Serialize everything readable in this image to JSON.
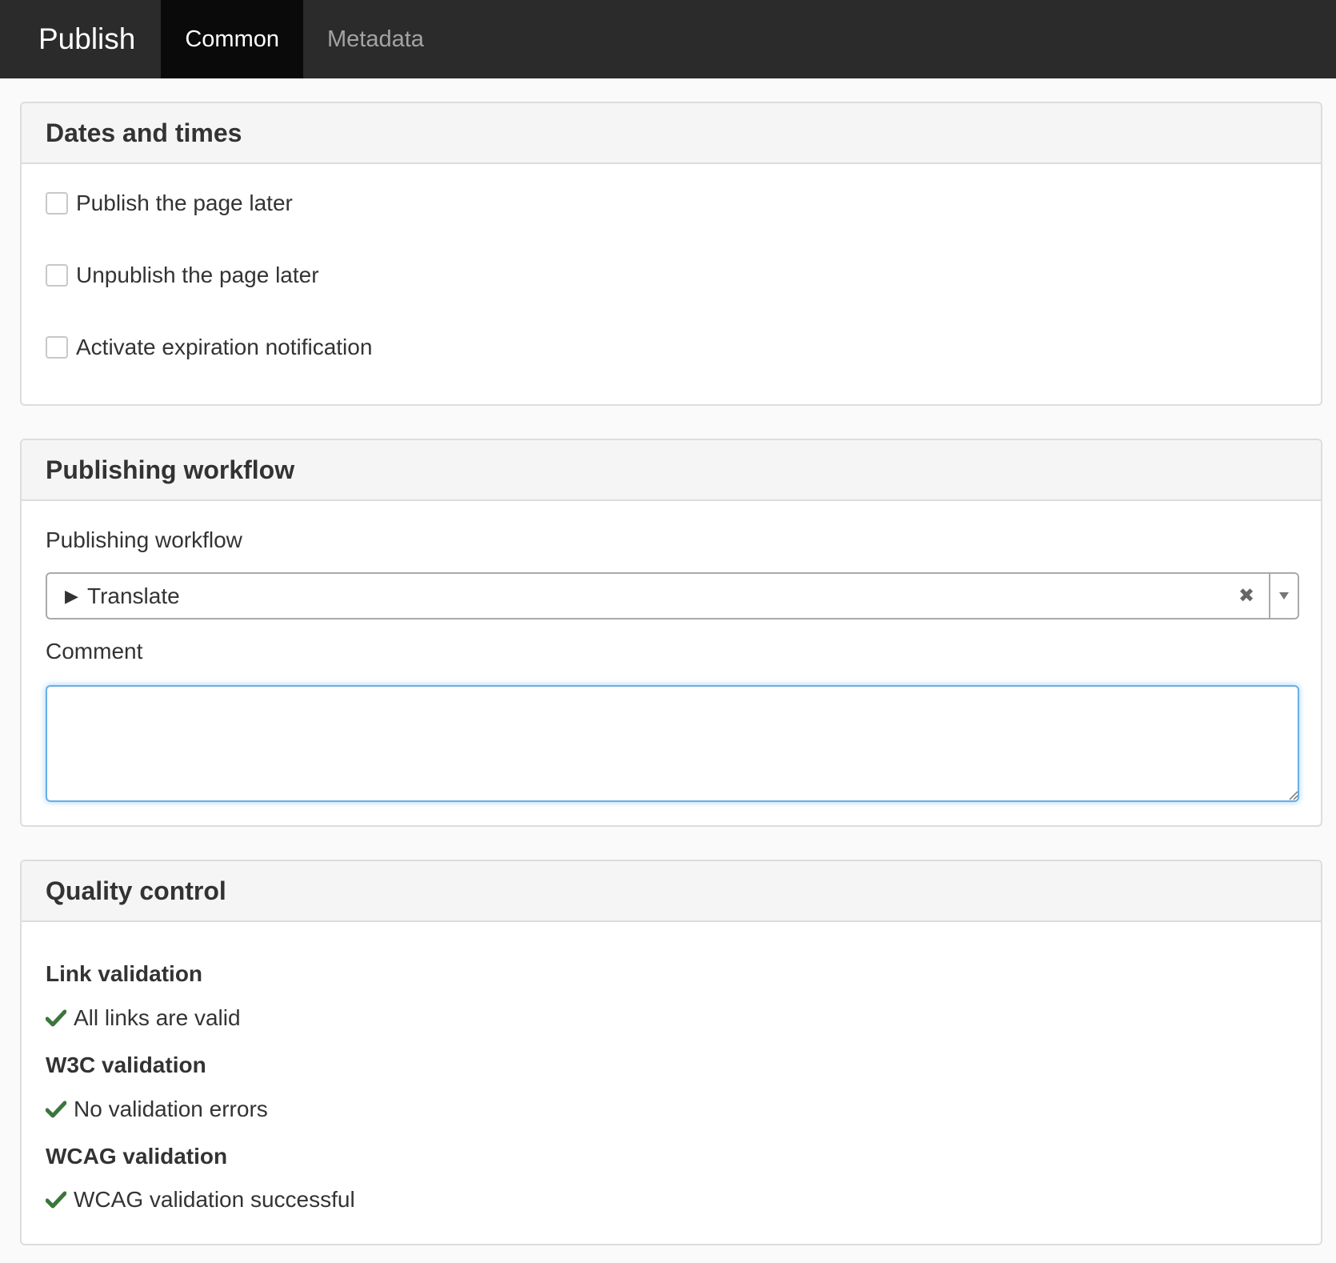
{
  "topbar": {
    "title": "Publish",
    "tabs": [
      {
        "label": "Common",
        "active": true
      },
      {
        "label": "Metadata",
        "active": false
      }
    ]
  },
  "dates_panel": {
    "heading": "Dates and times",
    "options": [
      {
        "label": "Publish the page later",
        "checked": false
      },
      {
        "label": "Unpublish the page later",
        "checked": false
      },
      {
        "label": "Activate expiration notification",
        "checked": false
      }
    ]
  },
  "workflow_panel": {
    "heading": "Publishing workflow",
    "workflow_label": "Publishing workflow",
    "workflow_selected": "Translate",
    "comment_label": "Comment",
    "comment_value": ""
  },
  "quality_panel": {
    "heading": "Quality control",
    "checks": [
      {
        "title": "Link validation",
        "result": "All links are valid"
      },
      {
        "title": "W3C validation",
        "result": "No validation errors"
      },
      {
        "title": "WCAG validation",
        "result": "WCAG validation successful"
      }
    ]
  },
  "colors": {
    "topbar_bg": "#2b2b2b",
    "active_tab_bg": "#0a0a0a",
    "success_green": "#3c763d",
    "focus_blue": "#66afe9"
  }
}
